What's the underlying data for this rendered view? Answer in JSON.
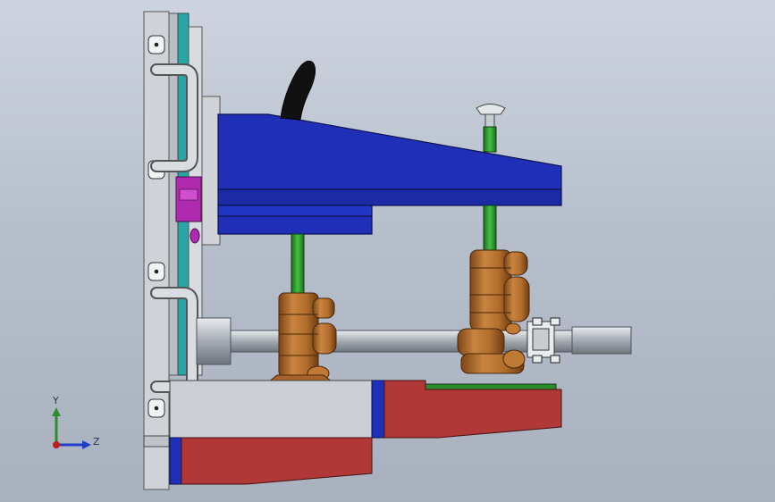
{
  "view": {
    "background_top": "#cdd4df",
    "background_bottom": "#a9b1bf"
  },
  "triad": {
    "y_label": "Y",
    "z_label": "Z",
    "y_color": "#2e8b2e",
    "z_color": "#1f3fc8",
    "origin_color": "#c21b1b"
  },
  "colors": {
    "plate": "#cfd3d8",
    "teal": "#2aa5a5",
    "blue_body": "#1f2fb8",
    "green_rod": "#2c9a2c",
    "bronze": "#b5702e",
    "red_block": "#b03838",
    "magenta": "#b02ab0",
    "grey_rod": "#b7bcc3",
    "handle": "#111111"
  }
}
